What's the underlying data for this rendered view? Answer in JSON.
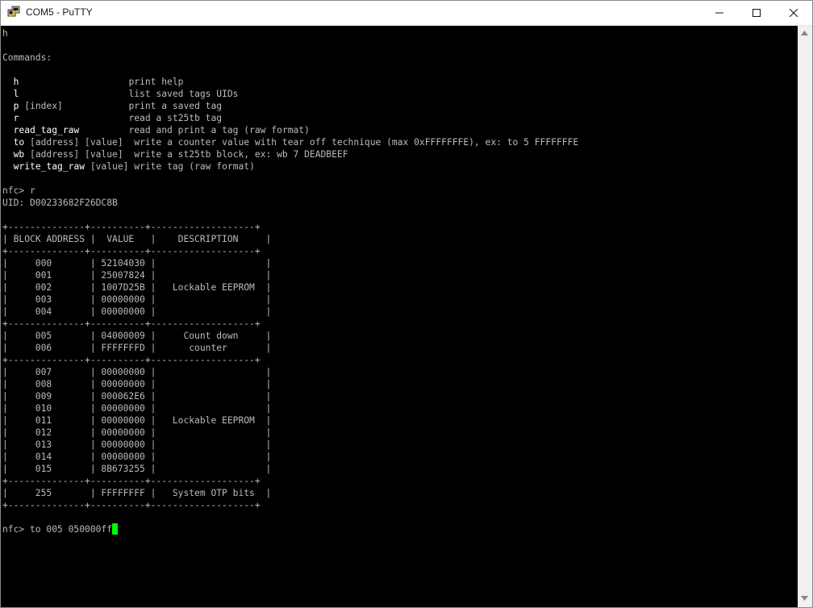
{
  "window": {
    "title": "COM5 - PuTTY",
    "accent_color": "#00ff00"
  },
  "terminal": {
    "lines": [
      "h",
      "",
      "Commands:",
      "",
      "  h                    print help",
      "  l                    list saved tags UIDs",
      "  p [index]            print a saved tag",
      "  r                    read a st25tb tag",
      "  read_tag_raw         read and print a tag (raw format)",
      "  to [address] [value]  write a counter value with tear off technique (max 0xFFFFFFFE), ex: to 5 FFFFFFFE",
      "  wb [address] [value]  write a st25tb block, ex: wb 7 DEADBEEF",
      "  write_tag_raw [value] write tag (raw format)",
      "",
      "nfc> r",
      "UID: D00233682F26DC8B",
      "",
      "+--------------+----------+-------------------+",
      "| BLOCK ADDRESS |  VALUE   |    DESCRIPTION     |",
      "+--------------+----------+-------------------+",
      "|     000       | 52104030 |                    |",
      "|     001       | 25007824 |                    |",
      "|     002       | 1007D25B |   Lockable EEPROM  |",
      "|     003       | 00000000 |                    |",
      "|     004       | 00000000 |                    |",
      "+--------------+----------+-------------------+",
      "|     005       | 04000009 |     Count down     |",
      "|     006       | FFFFFFFD |      counter       |",
      "+--------------+----------+-------------------+",
      "|     007       | 00000000 |                    |",
      "|     008       | 00000000 |                    |",
      "|     009       | 000062E6 |                    |",
      "|     010       | 00000000 |                    |",
      "|     011       | 00000000 |   Lockable EEPROM  |",
      "|     012       | 00000000 |                    |",
      "|     013       | 00000000 |                    |",
      "|     014       | 00000000 |                    |",
      "|     015       | 8B673255 |                    |",
      "+--------------+----------+-------------------+",
      "|     255       | FFFFFFFF |   System OTP bits  |",
      "+--------------+----------+-------------------+",
      "",
      "nfc> to 005 050000ff"
    ],
    "commands": [
      {
        "name": "h",
        "args": "",
        "pad": "                    ",
        "desc": "print help"
      },
      {
        "name": "l",
        "args": "",
        "pad": "                    ",
        "desc": "list saved tags UIDs"
      },
      {
        "name": "p",
        "args": " [index]",
        "pad": "            ",
        "desc": "print a saved tag"
      },
      {
        "name": "r",
        "args": "",
        "pad": "                    ",
        "desc": "read a st25tb tag"
      },
      {
        "name": "read_tag_raw",
        "args": "",
        "pad": "         ",
        "desc": "read and print a tag (raw format)"
      },
      {
        "name": "to",
        "args": " [address] [value]",
        "pad": "  ",
        "desc": "write a counter value with tear off technique (max 0xFFFFFFFE), ex: to 5 FFFFFFFE"
      },
      {
        "name": "wb",
        "args": " [address] [value]",
        "pad": "  ",
        "desc": "write a st25tb block, ex: wb 7 DEADBEEF"
      },
      {
        "name": "write_tag_raw",
        "args": " [value]",
        "pad": " ",
        "desc": "write tag (raw format)"
      }
    ],
    "prompt_line": "nfc> to 005 050000ff"
  }
}
